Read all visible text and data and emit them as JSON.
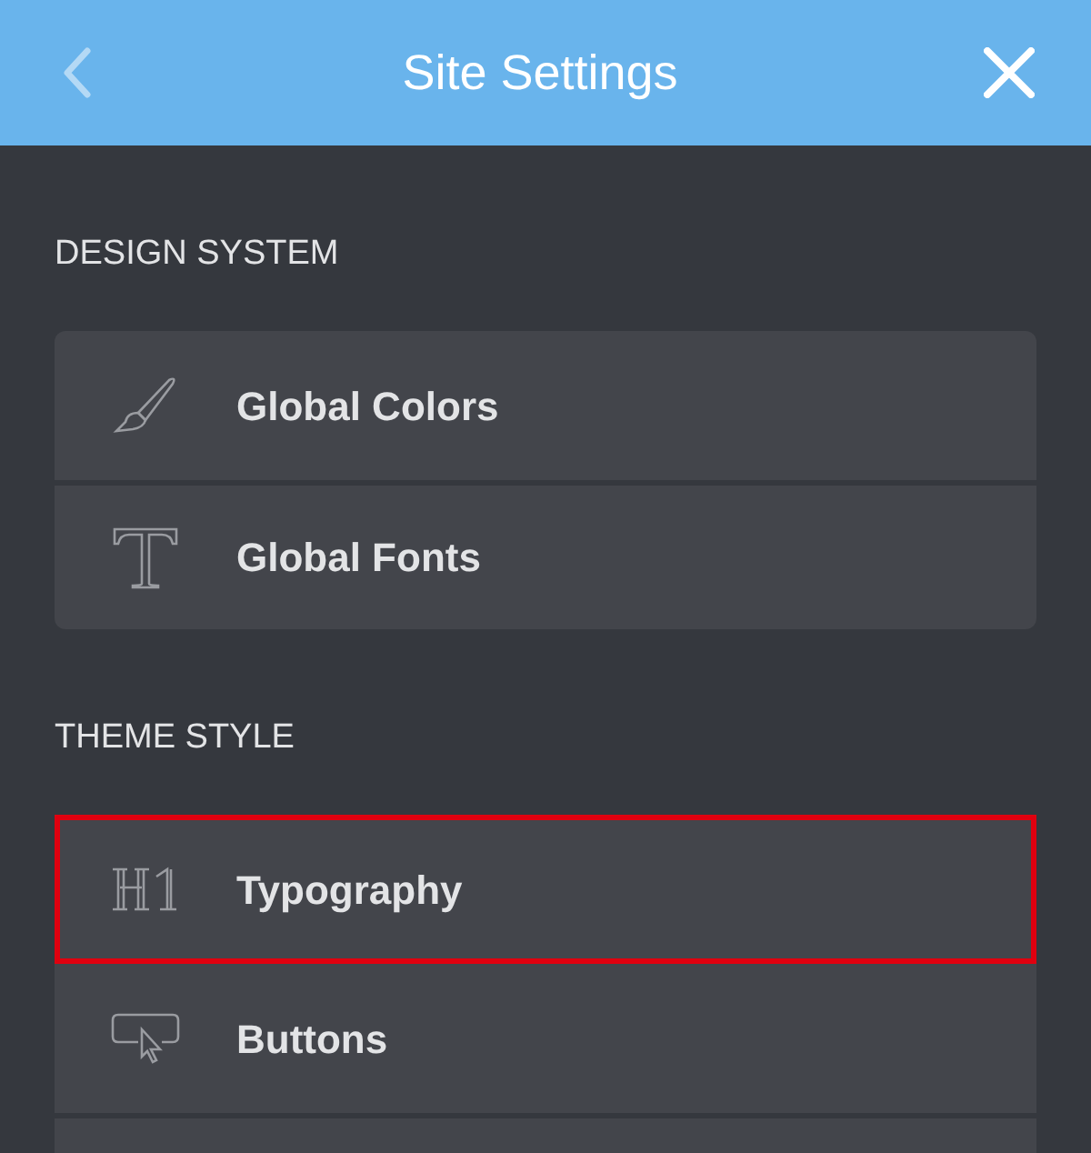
{
  "header": {
    "title": "Site Settings",
    "back_disabled": true
  },
  "sections": [
    {
      "heading": "DESIGN SYSTEM",
      "items": [
        {
          "label": "Global Colors",
          "kind": "brush",
          "highlighted": false
        },
        {
          "label": "Global Fonts",
          "kind": "serif-t",
          "highlighted": false
        }
      ]
    },
    {
      "heading": "THEME STYLE",
      "items": [
        {
          "label": "Typography",
          "kind": "h1",
          "highlighted": true
        },
        {
          "label": "Buttons",
          "kind": "pointer",
          "highlighted": false
        }
      ]
    }
  ]
}
